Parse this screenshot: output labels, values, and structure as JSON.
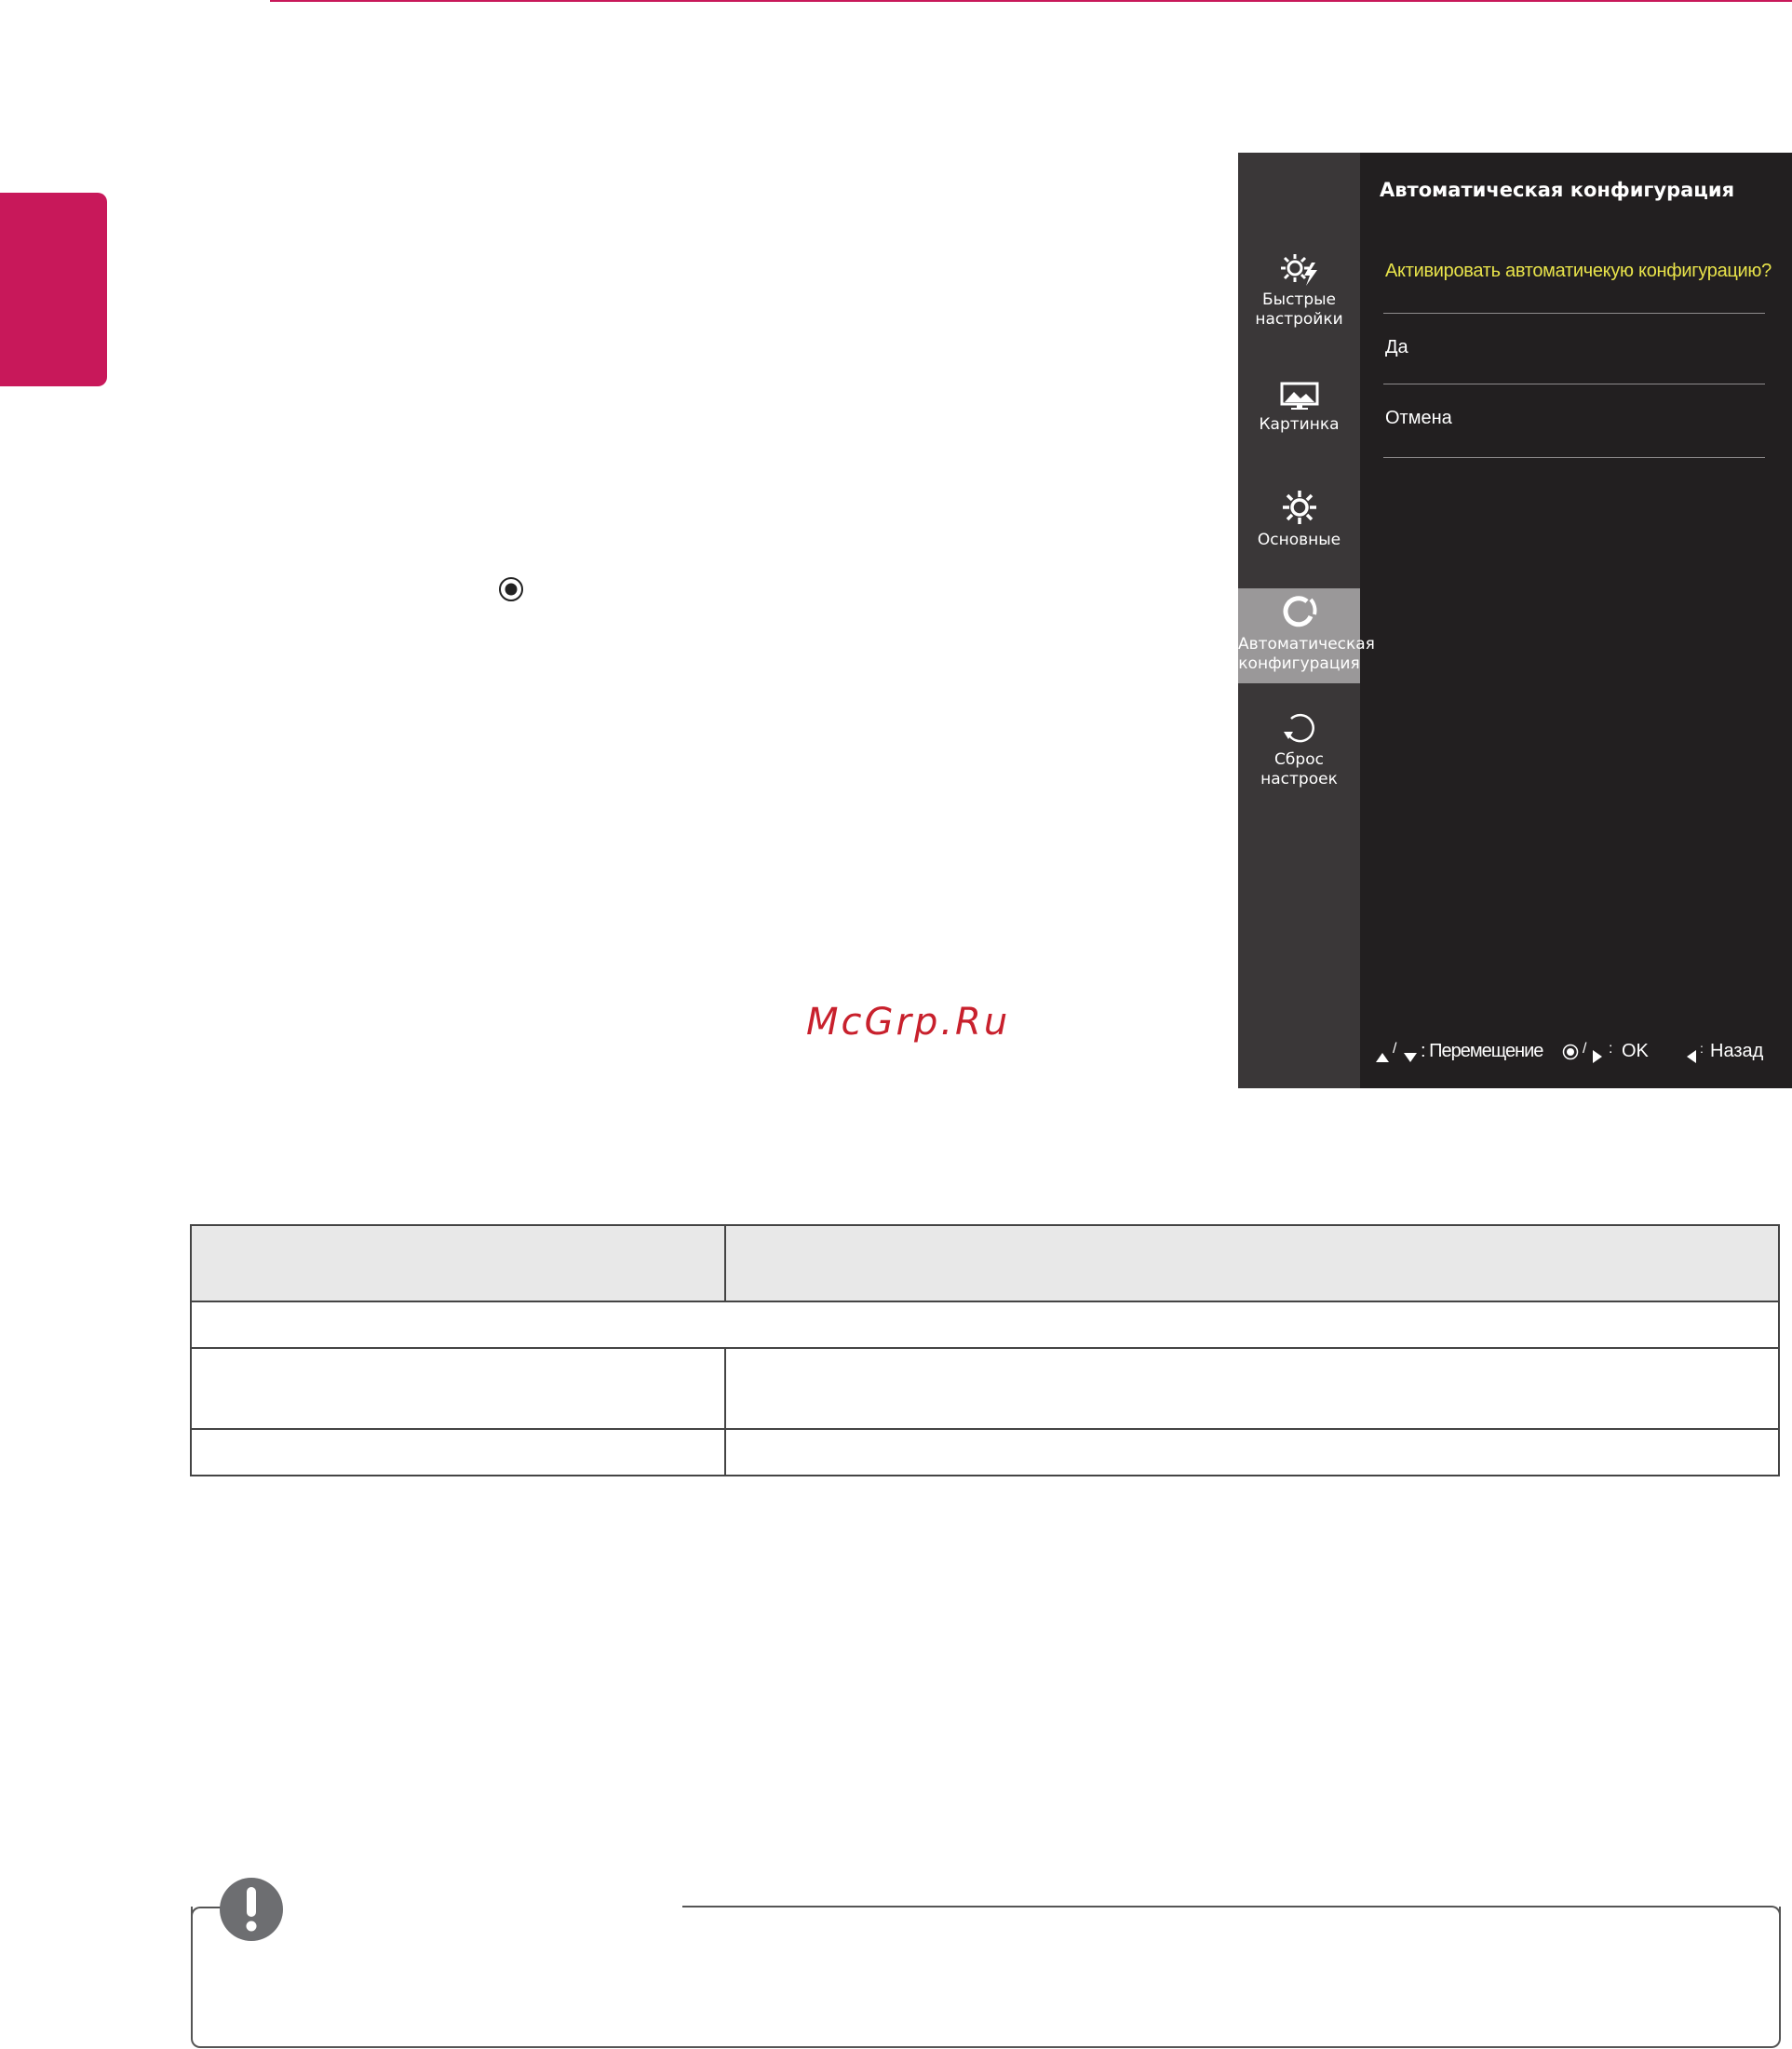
{
  "osd": {
    "title": "Автоматическая конфигурация",
    "question": "Активировать автоматичекую конфигурацию?",
    "options": [
      "Да",
      "Отмена"
    ],
    "sidebar": {
      "quick_line1": "Быстрые",
      "quick_line2": "настройки",
      "picture": "Картинка",
      "general": "Основные",
      "auto_line1": "Автоматическая",
      "auto_line2": "конфигурация",
      "reset_line1": "Сброс",
      "reset_line2": "настроек"
    },
    "footer": {
      "move": ": Перемещение",
      "ok": "OK",
      "back": "Назад"
    }
  },
  "watermark": "McGrp.Ru",
  "colors": {
    "accent": "#c8185a",
    "osd_background": "#221f20",
    "osd_sidebar": "#3a3738",
    "osd_highlight": "#e8e34a"
  }
}
